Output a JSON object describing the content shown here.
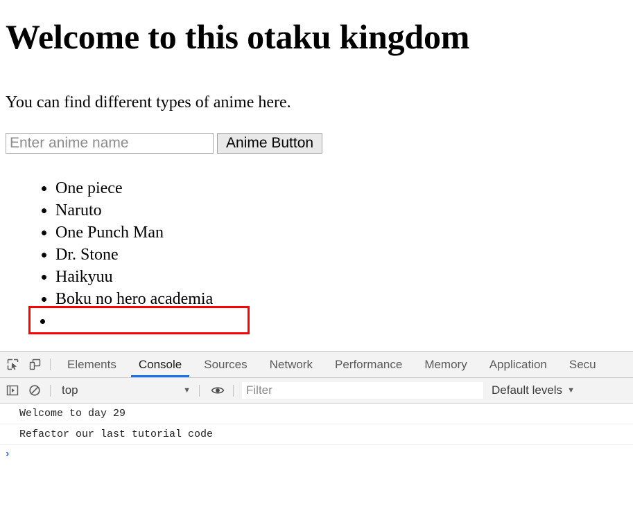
{
  "page": {
    "title": "Welcome to this otaku kingdom",
    "paragraph": "You can find different types of anime here.",
    "input_placeholder": "Enter anime name",
    "input_value": "",
    "button_label": "Anime Button",
    "anime_list": [
      "One piece",
      "Naruto",
      "One Punch Man",
      "Dr. Stone",
      "Haikyuu",
      "Boku no hero academia",
      ""
    ],
    "highlight_color": "#ff0000"
  },
  "devtools": {
    "icons": {
      "inspect": "inspect-element-icon",
      "device": "device-toolbar-icon",
      "sidebar": "console-sidebar-icon",
      "clear": "clear-console-icon",
      "eye": "live-expression-eye-icon"
    },
    "tabs": [
      {
        "label": "Elements",
        "active": false
      },
      {
        "label": "Console",
        "active": true
      },
      {
        "label": "Sources",
        "active": false
      },
      {
        "label": "Network",
        "active": false
      },
      {
        "label": "Performance",
        "active": false
      },
      {
        "label": "Memory",
        "active": false
      },
      {
        "label": "Application",
        "active": false
      },
      {
        "label": "Secu",
        "active": false
      }
    ],
    "active_tab_accent": "#1a73e8",
    "filterbar": {
      "context": "top",
      "context_caret": "▼",
      "filter_placeholder": "Filter",
      "filter_value": "",
      "levels_label": "Default levels",
      "levels_caret": "▼"
    },
    "console": {
      "messages": [
        "Welcome to day 29",
        "Refactor our last tutorial code"
      ],
      "prompt_symbol": "›",
      "prompt_value": "",
      "prompt_color": "#3b78e7"
    }
  }
}
